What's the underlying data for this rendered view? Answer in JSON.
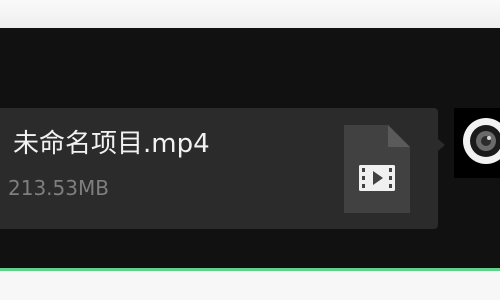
{
  "file_message": {
    "name": "未命名项目.mp4",
    "size": "213.53MB",
    "icon": "video-file-icon"
  },
  "avatar": {
    "icon": "camera-lens-icon"
  },
  "colors": {
    "chat_background": "#111111",
    "bubble_background": "#2b2b2b",
    "file_name_text": "#f2f2f2",
    "file_size_text": "#7f7f7f",
    "input_border_accent": "#5fd38a"
  }
}
